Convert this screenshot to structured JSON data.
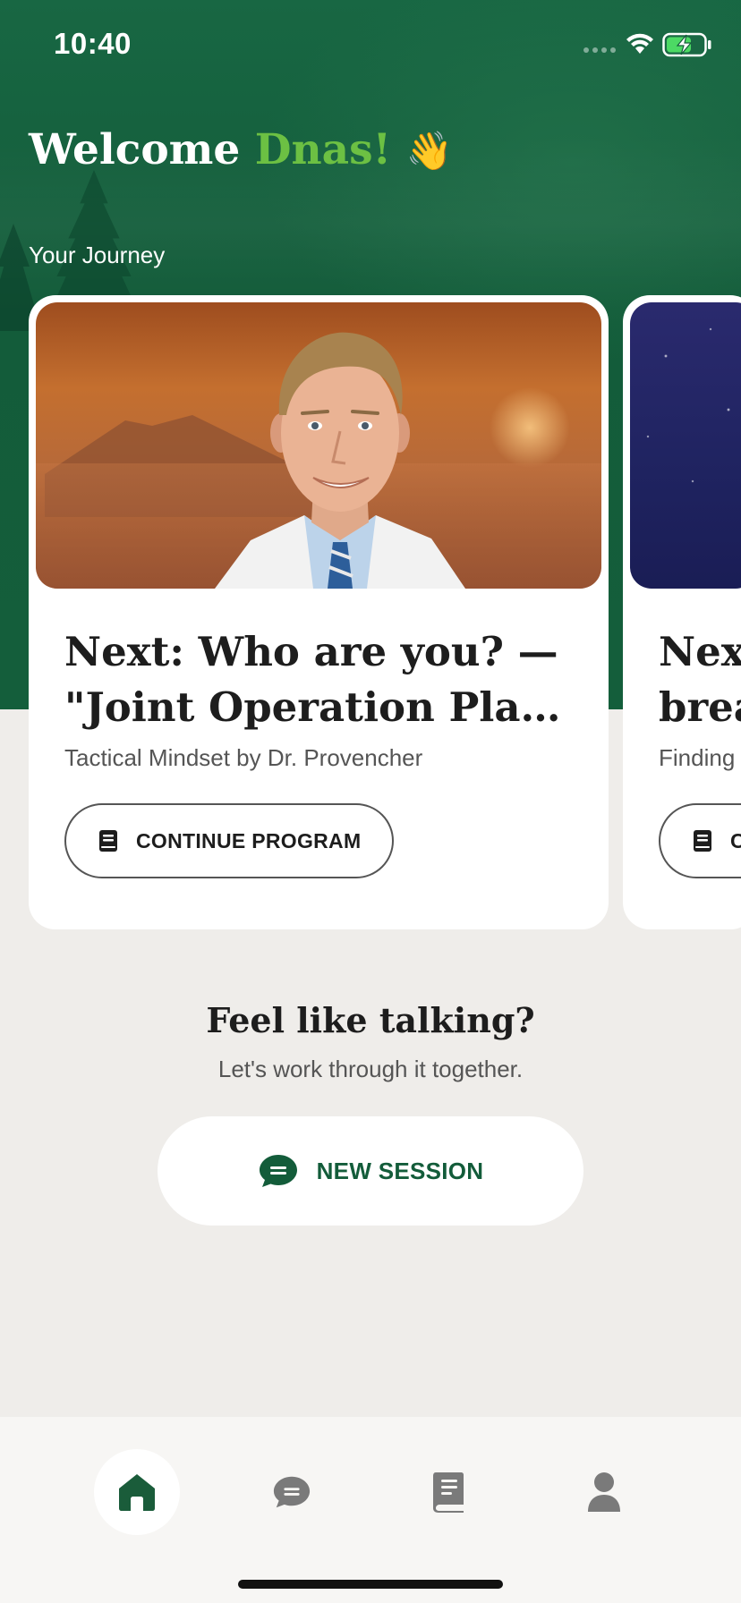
{
  "status_bar": {
    "time": "10:40",
    "icons": [
      "cellular-signal-icon",
      "wifi-icon",
      "battery-charging-icon"
    ]
  },
  "header": {
    "welcome_prefix": "Welcome",
    "user_name": "Dnas!",
    "wave_emoji": "👋",
    "section_label": "Your Journey"
  },
  "journey_cards": [
    {
      "title_line1": "Next: Who are you? —",
      "title_line2": "\"Joint Operation Plan...",
      "subtitle": "Tactical Mindset by  Dr. Provencher",
      "button_label": "CONTINUE PROGRAM",
      "button_icon": "book-icon"
    },
    {
      "title_line1": "Next",
      "title_line2": "brea",
      "subtitle": "Finding",
      "button_label": "C",
      "button_icon": "book-icon"
    }
  ],
  "talk": {
    "title": "Feel like talking?",
    "subtitle": "Let's work through it together.",
    "button_label": "NEW SESSION",
    "button_icon": "chat-bubble-icon"
  },
  "tab_bar": {
    "items": [
      {
        "name": "home",
        "icon": "home-icon",
        "active": true
      },
      {
        "name": "chat",
        "icon": "chat-bubble-icon",
        "active": false
      },
      {
        "name": "library",
        "icon": "book-icon",
        "active": false
      },
      {
        "name": "profile",
        "icon": "person-icon",
        "active": false
      }
    ]
  },
  "colors": {
    "brand_green": "#135c3a",
    "accent_green": "#6cc043",
    "background": "#efedea",
    "tab_active": "#1a5c3a",
    "tab_inactive": "#7a7a7a"
  }
}
